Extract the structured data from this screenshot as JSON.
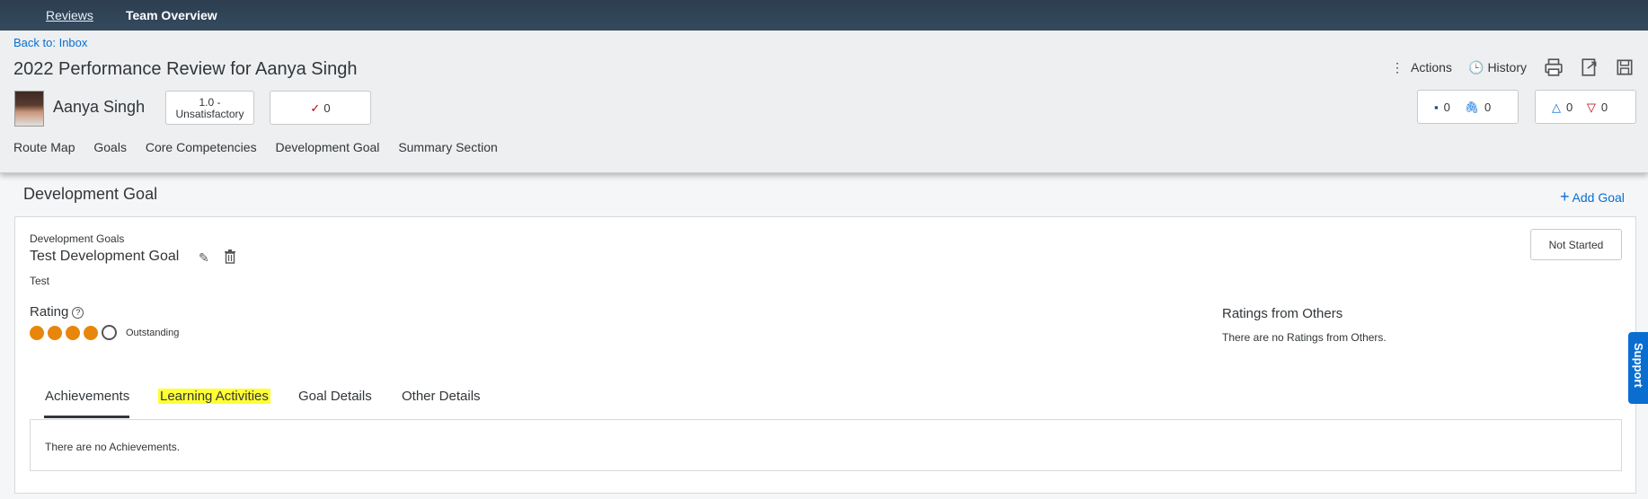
{
  "topnav": {
    "reviews": "Reviews",
    "team_overview": "Team Overview"
  },
  "header": {
    "back_link": "Back to: Inbox",
    "title": "2022 Performance Review for Aanya Singh",
    "employee_name": "Aanya Singh",
    "rating_line1": "1.0 -",
    "rating_line2": "Unsatisfactory",
    "check_count": "0",
    "actions_label": "Actions",
    "history_label": "History",
    "comments_count": "0",
    "attachments_count": "0",
    "up_count": "0",
    "down_count": "0",
    "tabs": [
      "Route Map",
      "Goals",
      "Core Competencies",
      "Development Goal",
      "Summary Section"
    ]
  },
  "section": {
    "title": "Development Goal",
    "add_goal": "Add Goal"
  },
  "goal": {
    "group_label": "Development Goals",
    "name": "Test Development Goal",
    "description": "Test",
    "status": "Not Started",
    "rating_label": "Rating",
    "rating_text": "Outstanding",
    "rating_value": 4,
    "rating_max": 5,
    "others_label": "Ratings from Others",
    "others_text": "There are no Ratings from Others."
  },
  "goal_tabs": {
    "achievements": "Achievements",
    "learning": "Learning Activities",
    "details": "Goal Details",
    "other": "Other Details",
    "achievements_empty": "There are no Achievements."
  },
  "support": "Support",
  "colors": {
    "accent": "#0a6ed1",
    "rating": "#e8860c",
    "highlight": "#ffff33"
  }
}
